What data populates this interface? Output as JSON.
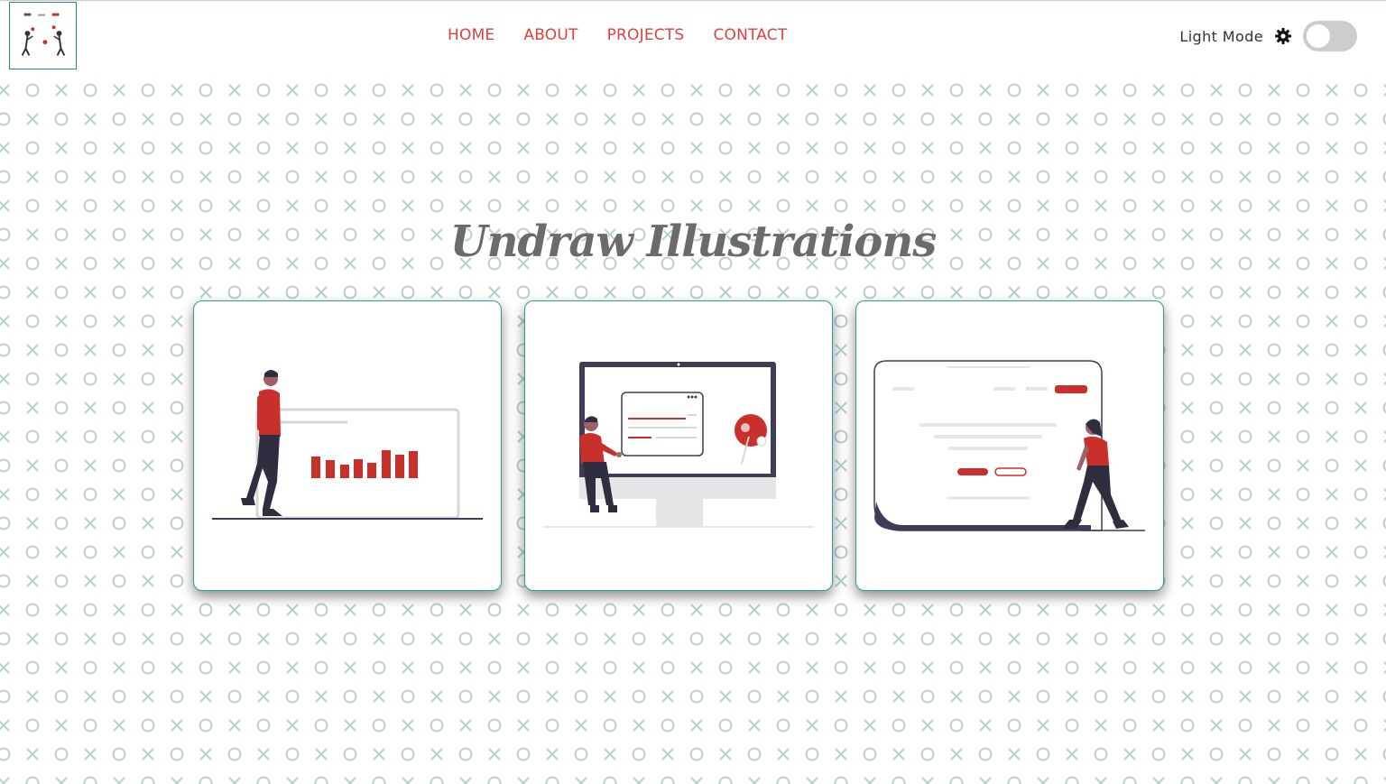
{
  "header": {
    "nav": [
      {
        "label": "HOME"
      },
      {
        "label": "ABOUT"
      },
      {
        "label": "PROJECTS"
      },
      {
        "label": "CONTACT"
      }
    ],
    "theme_label": "Light Mode",
    "theme_icon": "gear-icon",
    "toggle_state": "off"
  },
  "main": {
    "title": "Undraw Illustrations",
    "cards": [
      {
        "illustration": "presentation-chart-illustration"
      },
      {
        "illustration": "monitor-dashboard-illustration"
      },
      {
        "illustration": "landing-page-illustration"
      }
    ]
  },
  "colors": {
    "accent": "#e0403f",
    "illustration_red": "#c9302c",
    "card_border": "#2a9d9d",
    "pattern": "#b9cfcf",
    "title": "#6b6b6b"
  }
}
